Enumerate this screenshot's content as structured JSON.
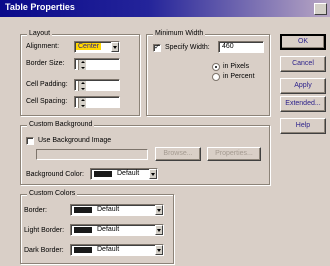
{
  "window": {
    "title": "Table Properties"
  },
  "layout_group": {
    "label": "Layout",
    "alignment_label": "Alignment:",
    "alignment_value": "Center",
    "border_label": "Border Size:",
    "border_value": "0",
    "padding_label": "Cell Padding:",
    "padding_value": "5",
    "spacing_label": "Cell Spacing:",
    "spacing_value": "15"
  },
  "min_width": {
    "label": "Minimum Width",
    "specify_label": "Specify Width:",
    "specify_checked": true,
    "width_value": "460",
    "pixels_label": "in Pixels",
    "percent_label": "in Percent",
    "selected_unit": "pixels"
  },
  "background": {
    "label": "Custom Background",
    "use_image_label": "Use Background Image",
    "use_image_checked": false,
    "browse_label": "Browse...",
    "properties_label": "Properties...",
    "color_label": "Background Color:",
    "color_value": "Default"
  },
  "colors": {
    "label": "Custom Colors",
    "border_label": "Border:",
    "border_value": "Default",
    "light_label": "Light Border:",
    "light_value": "Default",
    "dark_label": "Dark Border:",
    "dark_value": "Default"
  },
  "buttons": {
    "ok": "OK",
    "cancel": "Cancel",
    "apply": "Apply",
    "extended": "Extended...",
    "help": "Help"
  },
  "accent_colors": {
    "title_bar": "#0a0a8a",
    "highlight": "#ffd700",
    "button_text": "#2a1f8a"
  },
  "icons": {
    "close": "close-icon",
    "dropdown": "chevron-down-icon",
    "spinner": "spinner-icon",
    "checkmark": "check-icon"
  }
}
